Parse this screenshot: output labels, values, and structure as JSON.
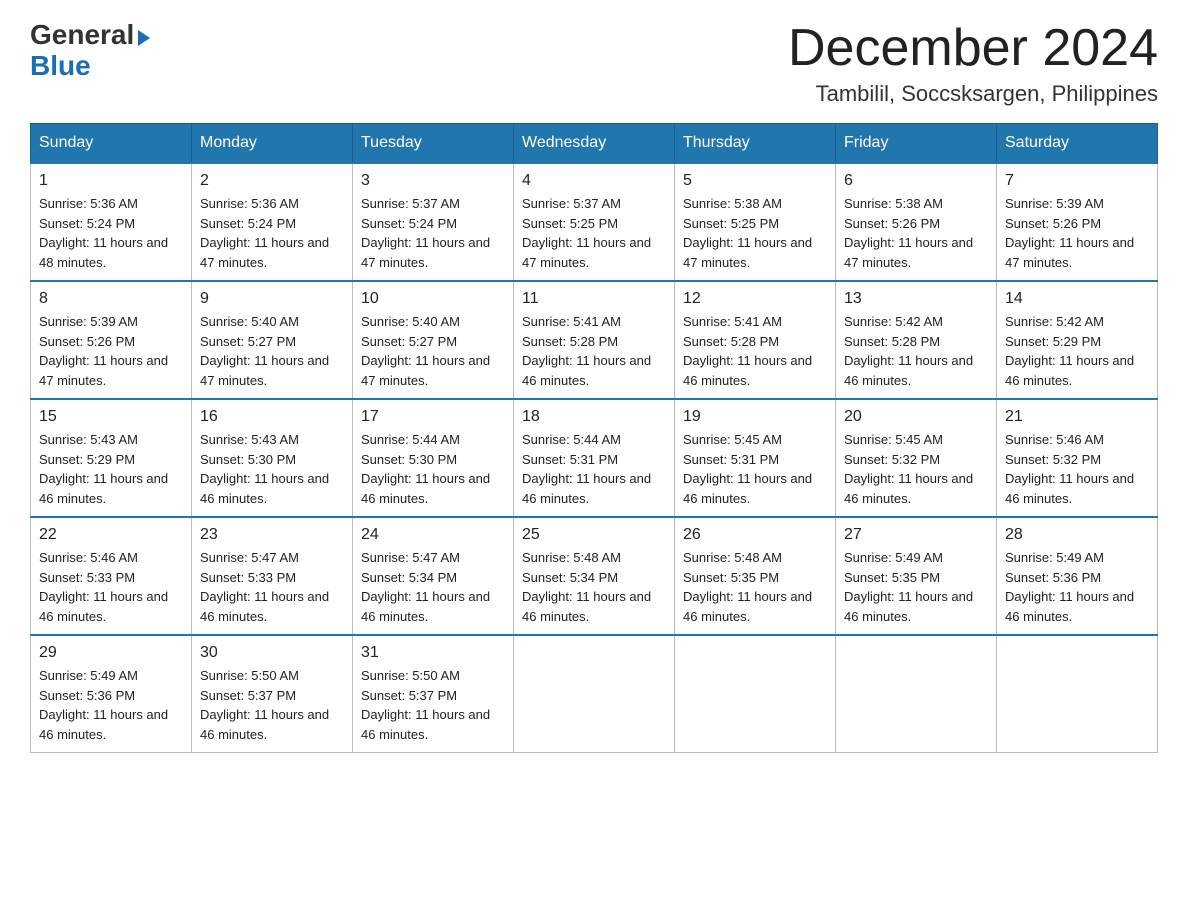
{
  "header": {
    "logo": {
      "general": "General",
      "blue": "Blue",
      "triangle_char": "▶"
    },
    "month_title": "December 2024",
    "location": "Tambilil, Soccsksargen, Philippines"
  },
  "weekdays": [
    "Sunday",
    "Monday",
    "Tuesday",
    "Wednesday",
    "Thursday",
    "Friday",
    "Saturday"
  ],
  "weeks": [
    [
      {
        "day": "1",
        "sunrise": "5:36 AM",
        "sunset": "5:24 PM",
        "daylight": "11 hours and 48 minutes."
      },
      {
        "day": "2",
        "sunrise": "5:36 AM",
        "sunset": "5:24 PM",
        "daylight": "11 hours and 47 minutes."
      },
      {
        "day": "3",
        "sunrise": "5:37 AM",
        "sunset": "5:24 PM",
        "daylight": "11 hours and 47 minutes."
      },
      {
        "day": "4",
        "sunrise": "5:37 AM",
        "sunset": "5:25 PM",
        "daylight": "11 hours and 47 minutes."
      },
      {
        "day": "5",
        "sunrise": "5:38 AM",
        "sunset": "5:25 PM",
        "daylight": "11 hours and 47 minutes."
      },
      {
        "day": "6",
        "sunrise": "5:38 AM",
        "sunset": "5:26 PM",
        "daylight": "11 hours and 47 minutes."
      },
      {
        "day": "7",
        "sunrise": "5:39 AM",
        "sunset": "5:26 PM",
        "daylight": "11 hours and 47 minutes."
      }
    ],
    [
      {
        "day": "8",
        "sunrise": "5:39 AM",
        "sunset": "5:26 PM",
        "daylight": "11 hours and 47 minutes."
      },
      {
        "day": "9",
        "sunrise": "5:40 AM",
        "sunset": "5:27 PM",
        "daylight": "11 hours and 47 minutes."
      },
      {
        "day": "10",
        "sunrise": "5:40 AM",
        "sunset": "5:27 PM",
        "daylight": "11 hours and 47 minutes."
      },
      {
        "day": "11",
        "sunrise": "5:41 AM",
        "sunset": "5:28 PM",
        "daylight": "11 hours and 46 minutes."
      },
      {
        "day": "12",
        "sunrise": "5:41 AM",
        "sunset": "5:28 PM",
        "daylight": "11 hours and 46 minutes."
      },
      {
        "day": "13",
        "sunrise": "5:42 AM",
        "sunset": "5:28 PM",
        "daylight": "11 hours and 46 minutes."
      },
      {
        "day": "14",
        "sunrise": "5:42 AM",
        "sunset": "5:29 PM",
        "daylight": "11 hours and 46 minutes."
      }
    ],
    [
      {
        "day": "15",
        "sunrise": "5:43 AM",
        "sunset": "5:29 PM",
        "daylight": "11 hours and 46 minutes."
      },
      {
        "day": "16",
        "sunrise": "5:43 AM",
        "sunset": "5:30 PM",
        "daylight": "11 hours and 46 minutes."
      },
      {
        "day": "17",
        "sunrise": "5:44 AM",
        "sunset": "5:30 PM",
        "daylight": "11 hours and 46 minutes."
      },
      {
        "day": "18",
        "sunrise": "5:44 AM",
        "sunset": "5:31 PM",
        "daylight": "11 hours and 46 minutes."
      },
      {
        "day": "19",
        "sunrise": "5:45 AM",
        "sunset": "5:31 PM",
        "daylight": "11 hours and 46 minutes."
      },
      {
        "day": "20",
        "sunrise": "5:45 AM",
        "sunset": "5:32 PM",
        "daylight": "11 hours and 46 minutes."
      },
      {
        "day": "21",
        "sunrise": "5:46 AM",
        "sunset": "5:32 PM",
        "daylight": "11 hours and 46 minutes."
      }
    ],
    [
      {
        "day": "22",
        "sunrise": "5:46 AM",
        "sunset": "5:33 PM",
        "daylight": "11 hours and 46 minutes."
      },
      {
        "day": "23",
        "sunrise": "5:47 AM",
        "sunset": "5:33 PM",
        "daylight": "11 hours and 46 minutes."
      },
      {
        "day": "24",
        "sunrise": "5:47 AM",
        "sunset": "5:34 PM",
        "daylight": "11 hours and 46 minutes."
      },
      {
        "day": "25",
        "sunrise": "5:48 AM",
        "sunset": "5:34 PM",
        "daylight": "11 hours and 46 minutes."
      },
      {
        "day": "26",
        "sunrise": "5:48 AM",
        "sunset": "5:35 PM",
        "daylight": "11 hours and 46 minutes."
      },
      {
        "day": "27",
        "sunrise": "5:49 AM",
        "sunset": "5:35 PM",
        "daylight": "11 hours and 46 minutes."
      },
      {
        "day": "28",
        "sunrise": "5:49 AM",
        "sunset": "5:36 PM",
        "daylight": "11 hours and 46 minutes."
      }
    ],
    [
      {
        "day": "29",
        "sunrise": "5:49 AM",
        "sunset": "5:36 PM",
        "daylight": "11 hours and 46 minutes."
      },
      {
        "day": "30",
        "sunrise": "5:50 AM",
        "sunset": "5:37 PM",
        "daylight": "11 hours and 46 minutes."
      },
      {
        "day": "31",
        "sunrise": "5:50 AM",
        "sunset": "5:37 PM",
        "daylight": "11 hours and 46 minutes."
      },
      null,
      null,
      null,
      null
    ]
  ]
}
